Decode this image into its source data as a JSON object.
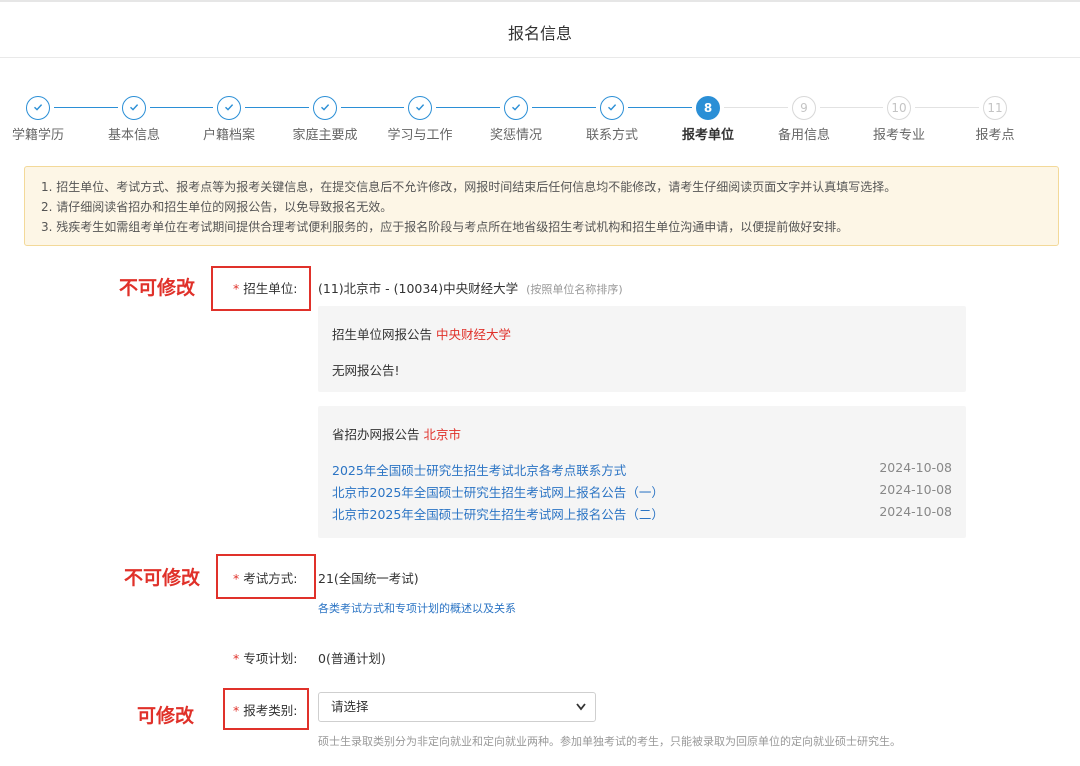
{
  "header": {
    "title": "报名信息"
  },
  "steps": [
    {
      "label": "学籍学历",
      "state": "done",
      "icon": "check-icon"
    },
    {
      "label": "基本信息",
      "state": "done",
      "icon": "check-icon"
    },
    {
      "label": "户籍档案",
      "state": "done",
      "icon": "check-icon"
    },
    {
      "label": "家庭主要成",
      "state": "done",
      "icon": "check-icon"
    },
    {
      "label": "学习与工作",
      "state": "done",
      "icon": "check-icon"
    },
    {
      "label": "奖惩情况",
      "state": "done",
      "icon": "check-icon"
    },
    {
      "label": "联系方式",
      "state": "done",
      "icon": "check-icon"
    },
    {
      "label": "报考单位",
      "state": "current",
      "number": "8"
    },
    {
      "label": "备用信息",
      "state": "future",
      "number": "9"
    },
    {
      "label": "报考专业",
      "state": "future",
      "number": "10"
    },
    {
      "label": "报考点",
      "state": "future",
      "number": "11"
    }
  ],
  "notice": {
    "lines": [
      "1. 招生单位、考试方式、报考点等为报考关键信息，在提交信息后不允许修改，网报时间结束后任何信息均不能修改，请考生仔细阅读页面文字并认真填写选择。",
      "2. 请仔细阅读省招办和招生单位的网报公告，以免导致报名无效。",
      "3. 残疾考生如需组考单位在考试期间提供合理考试便利服务的，应于报名阶段与考点所在地省级招生考试机构和招生单位沟通申请，以便提前做好安排。"
    ]
  },
  "annotations": {
    "not_editable": "不可修改",
    "editable": "可修改"
  },
  "form": {
    "unit": {
      "star": "*",
      "label": "招生单位:",
      "value": "(11)北京市 - (10034)中央财经大学",
      "hint": "(按照单位名称排序)"
    },
    "unit_notice": {
      "title": "招生单位网报公告",
      "title_highlight": "中央财经大学",
      "empty_text": "无网报公告!"
    },
    "province_notice": {
      "title": "省招办网报公告",
      "title_highlight": "北京市",
      "items": [
        {
          "text": "2025年全国硕士研究生招生考试北京各考点联系方式",
          "date": "2024-10-08"
        },
        {
          "text": "北京市2025年全国硕士研究生招生考试网上报名公告（一）",
          "date": "2024-10-08"
        },
        {
          "text": "北京市2025年全国硕士研究生招生考试网上报名公告（二）",
          "date": "2024-10-08"
        }
      ]
    },
    "exam_mode": {
      "star": "*",
      "label": "考试方式:",
      "value": "21(全国统一考试)",
      "link": "各类考试方式和专项计划的概述以及关系"
    },
    "special_plan": {
      "star": "*",
      "label": "专项计划:",
      "value": "0(普通计划)"
    },
    "category": {
      "star": "*",
      "label": "报考类别:",
      "selected": "请选择",
      "hint": "硕士生录取类别分为非定向就业和定向就业两种。参加单独考试的考生，只能被录取为回原单位的定向就业硕士研究生。"
    }
  },
  "colors": {
    "accent": "#2b8fd6",
    "link": "#2b74c4",
    "annotation": "#e0312a",
    "notice_bg": "#fdf6e6"
  }
}
